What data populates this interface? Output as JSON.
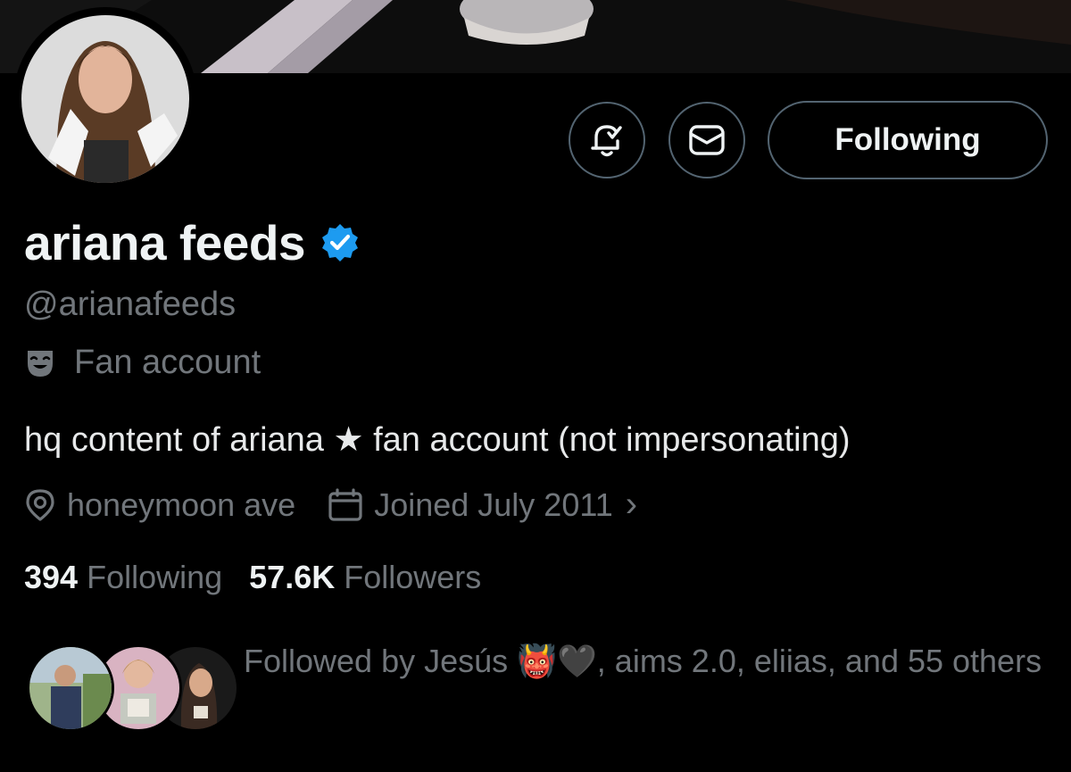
{
  "profile": {
    "display_name": "ariana feeds",
    "handle": "@arianafeeds",
    "category": "Fan account",
    "bio": "hq content of ariana ★ fan account (not impersonating)",
    "location": "honeymoon ave",
    "joined": "Joined July 2011",
    "joined_chevron": "›",
    "verified_color": "#1d9bf0"
  },
  "actions": {
    "follow_label": "Following"
  },
  "stats": {
    "following_count": "394",
    "following_label": "Following",
    "followers_count": "57.6K",
    "followers_label": "Followers"
  },
  "followed_by": {
    "prefix": "Followed by Jesús ",
    "emoji": "👹🖤",
    "suffix": ", aims 2.0, eliias, and 55 others"
  },
  "icons": {
    "notifications": "bell-check-icon",
    "message": "envelope-icon",
    "verified": "verified-badge-icon",
    "category": "theater-mask-icon",
    "location": "location-pin-icon",
    "calendar": "calendar-icon"
  }
}
